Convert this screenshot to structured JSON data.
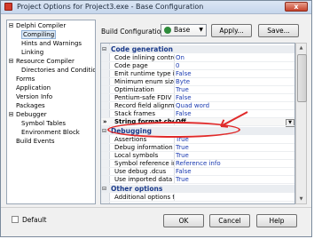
{
  "window": {
    "title": "Project Options for Project3.exe - Base Configuration",
    "close": "x"
  },
  "tree": {
    "items": [
      {
        "label": "Delphi Compiler",
        "level": 0,
        "expandable": true
      },
      {
        "label": "Compiling",
        "level": 1,
        "selected": true
      },
      {
        "label": "Hints and Warnings",
        "level": 1
      },
      {
        "label": "Linking",
        "level": 1
      },
      {
        "label": "Resource Compiler",
        "level": 0,
        "expandable": true
      },
      {
        "label": "Directories and Conditio",
        "level": 1
      },
      {
        "label": "Forms",
        "level": 0
      },
      {
        "label": "Application",
        "level": 0
      },
      {
        "label": "Version Info",
        "level": 0
      },
      {
        "label": "Packages",
        "level": 0
      },
      {
        "label": "Debugger",
        "level": 0,
        "expandable": true
      },
      {
        "label": "Symbol Tables",
        "level": 1
      },
      {
        "label": "Environment Block",
        "level": 1
      },
      {
        "label": "Build Events",
        "level": 0
      }
    ]
  },
  "build": {
    "label": "Build Configuration",
    "value": "Base",
    "apply": "Apply...",
    "save": "Save..."
  },
  "grid": {
    "code_generation": {
      "title": "Code generation",
      "toggle": "⊟",
      "rows": [
        {
          "name": "Code inlining control",
          "value": "On"
        },
        {
          "name": "Code page",
          "value": "0"
        },
        {
          "name": "Emit runtime type infor",
          "value": "False"
        },
        {
          "name": "Minimum enum size",
          "value": "Byte"
        },
        {
          "name": "Optimization",
          "value": "True"
        },
        {
          "name": "Pentium-safe FDIV",
          "value": "False"
        },
        {
          "name": "Record field alignment",
          "value": "Quad word"
        },
        {
          "name": "Stack frames",
          "value": "False"
        },
        {
          "name": "String format checking",
          "value": "Off",
          "mark": "»"
        }
      ]
    },
    "debugging": {
      "title": "Debugging",
      "toggle": "⊟",
      "rows": [
        {
          "name": "Assertions",
          "value": "True"
        },
        {
          "name": "Debug information",
          "value": "True"
        },
        {
          "name": "Local symbols",
          "value": "True"
        },
        {
          "name": "Symbol reference info",
          "value": "Reference info"
        },
        {
          "name": "Use debug .dcus",
          "value": "False"
        },
        {
          "name": "Use imported data refe",
          "value": "True"
        }
      ]
    },
    "other_options": {
      "title": "Other options",
      "toggle": "⊟",
      "rows": [
        {
          "name": "Additional options to p",
          "value": ""
        }
      ]
    }
  },
  "footer": {
    "default_label": "Default",
    "ok": "OK",
    "cancel": "Cancel",
    "help": "Help"
  },
  "colors": {
    "accent": "#e02a2a",
    "value_text": "#1a3ab0",
    "category_text": "#1a3a8a"
  }
}
